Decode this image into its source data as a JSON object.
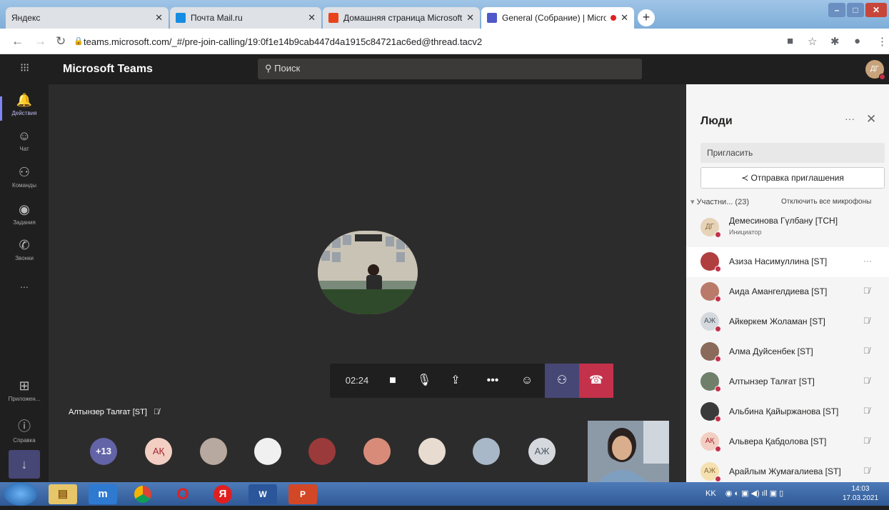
{
  "browser": {
    "tabs": [
      {
        "title": "Яндекс",
        "favicon": "yandex-icon",
        "active": false
      },
      {
        "title": "Почта Mail.ru",
        "favicon": "mail-icon",
        "active": false
      },
      {
        "title": "Домашняя страница Microsoft C",
        "favicon": "office-icon",
        "active": false
      },
      {
        "title": "General (Собрание) | Micros",
        "favicon": "teams-icon",
        "active": true,
        "recording": true
      }
    ],
    "url": "teams.microsoft.com/_#/pre-join-calling/19:0f1e14b9cab447d4a1915c84721ac6ed@thread.tacv2"
  },
  "teams": {
    "app_name": "Microsoft Teams",
    "search_placeholder": "Поиск",
    "user_initials": "ДГ",
    "rail": [
      {
        "label": "Действия",
        "icon": "bell-icon",
        "active": true
      },
      {
        "label": "Чат",
        "icon": "chat-icon",
        "active": false
      },
      {
        "label": "Команды",
        "icon": "teams-icon",
        "active": false
      },
      {
        "label": "Задания",
        "icon": "assignments-icon",
        "active": false
      },
      {
        "label": "Звонки",
        "icon": "phone-icon",
        "active": false
      },
      {
        "label": "...",
        "icon": "more-icon",
        "active": false
      },
      {
        "label": "Приложен...",
        "icon": "apps-icon",
        "active": false
      },
      {
        "label": "Справка",
        "icon": "help-icon",
        "active": false
      }
    ]
  },
  "call": {
    "timer": "02:24",
    "speaker_name": "Алтынзер Талғат [ST]",
    "overflow_count": "+13",
    "avatars": [
      {
        "initials": "АҚ",
        "color": "#f2cfc2",
        "text_color": "#a4262c"
      },
      {
        "initials": "",
        "color": "#b8a9a0"
      },
      {
        "initials": "",
        "color": "#f0f0f0"
      },
      {
        "initials": "",
        "color": "#9b3a3a"
      },
      {
        "initials": "",
        "color": "#d98b7a"
      },
      {
        "initials": "",
        "color": "#e8dcd0"
      },
      {
        "initials": "",
        "color": "#a8b8c8"
      },
      {
        "initials": "АЖ",
        "color": "#d5d9de",
        "text_color": "#4a5563"
      }
    ]
  },
  "people": {
    "title": "Люди",
    "invite_placeholder": "Пригласить",
    "send_invite": "Отправка приглашения",
    "participants_label": "Участни...",
    "participants_count": "(23)",
    "mute_all": "Отключить все микрофоны",
    "list": [
      {
        "name": "Демесинова Гүлбану [TCH]",
        "role": "Инициатор",
        "initials": "ДГ",
        "color": "#e6d3b8",
        "text_color": "#8a6d3b"
      },
      {
        "name": "Азиза Насимуллина [ST]",
        "role": "",
        "initials": "",
        "color": "#b04040",
        "highlight": true
      },
      {
        "name": "Аида Амангелдиева [ST]",
        "role": "",
        "initials": "",
        "color": "#b97a6a"
      },
      {
        "name": "Айкөркем Жоламан [ST]",
        "role": "",
        "initials": "АЖ",
        "color": "#d5d9de",
        "text_color": "#4a5563"
      },
      {
        "name": "Алма Дуйсенбек [ST]",
        "role": "",
        "initials": "",
        "color": "#8a6a5a"
      },
      {
        "name": "Алтынзер Талғат [ST]",
        "role": "",
        "initials": "",
        "color": "#6f7f6a"
      },
      {
        "name": "Альбина Қайыржанова [ST]",
        "role": "",
        "initials": "",
        "color": "#3a3a3a"
      },
      {
        "name": "Альвера Қабдолова [ST]",
        "role": "",
        "initials": "АҚ",
        "color": "#f2cfc2",
        "text_color": "#a4262c"
      },
      {
        "name": "Арайлым Жумағалиева [ST]",
        "role": "",
        "initials": "АЖ",
        "color": "#f5e0b0",
        "text_color": "#8a6d3b"
      }
    ]
  },
  "taskbar": {
    "language": "KK",
    "time": "14:03",
    "date": "17.03.2021"
  }
}
